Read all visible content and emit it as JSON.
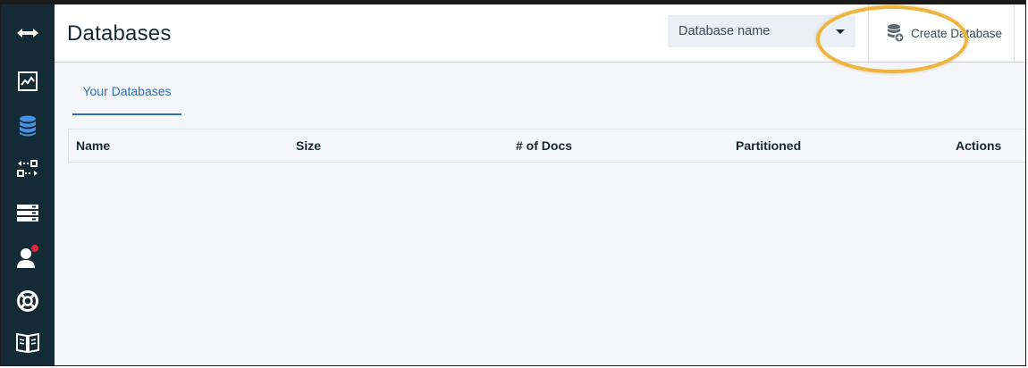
{
  "header": {
    "title": "Databases",
    "search": {
      "placeholder": "Database name"
    },
    "create_button_label": "Create Database",
    "highlight_color": "#efb43c"
  },
  "sidebar": {
    "background": "#142a36",
    "items": [
      {
        "icon": "expand-arrows-icon"
      },
      {
        "icon": "activity-chart-icon"
      },
      {
        "icon": "database-icon",
        "active": true
      },
      {
        "icon": "replication-icon"
      },
      {
        "icon": "server-icon"
      },
      {
        "icon": "user-icon",
        "notification": true
      },
      {
        "icon": "help-lifebuoy-icon"
      },
      {
        "icon": "documentation-book-icon"
      }
    ]
  },
  "tabs": [
    {
      "label": "Your Databases",
      "active": true
    }
  ],
  "table": {
    "columns": [
      "Name",
      "Size",
      "# of Docs",
      "Partitioned",
      "Actions"
    ],
    "rows": []
  },
  "colors": {
    "accent": "#2f6fb8",
    "active_icon": "#4a90e2"
  }
}
